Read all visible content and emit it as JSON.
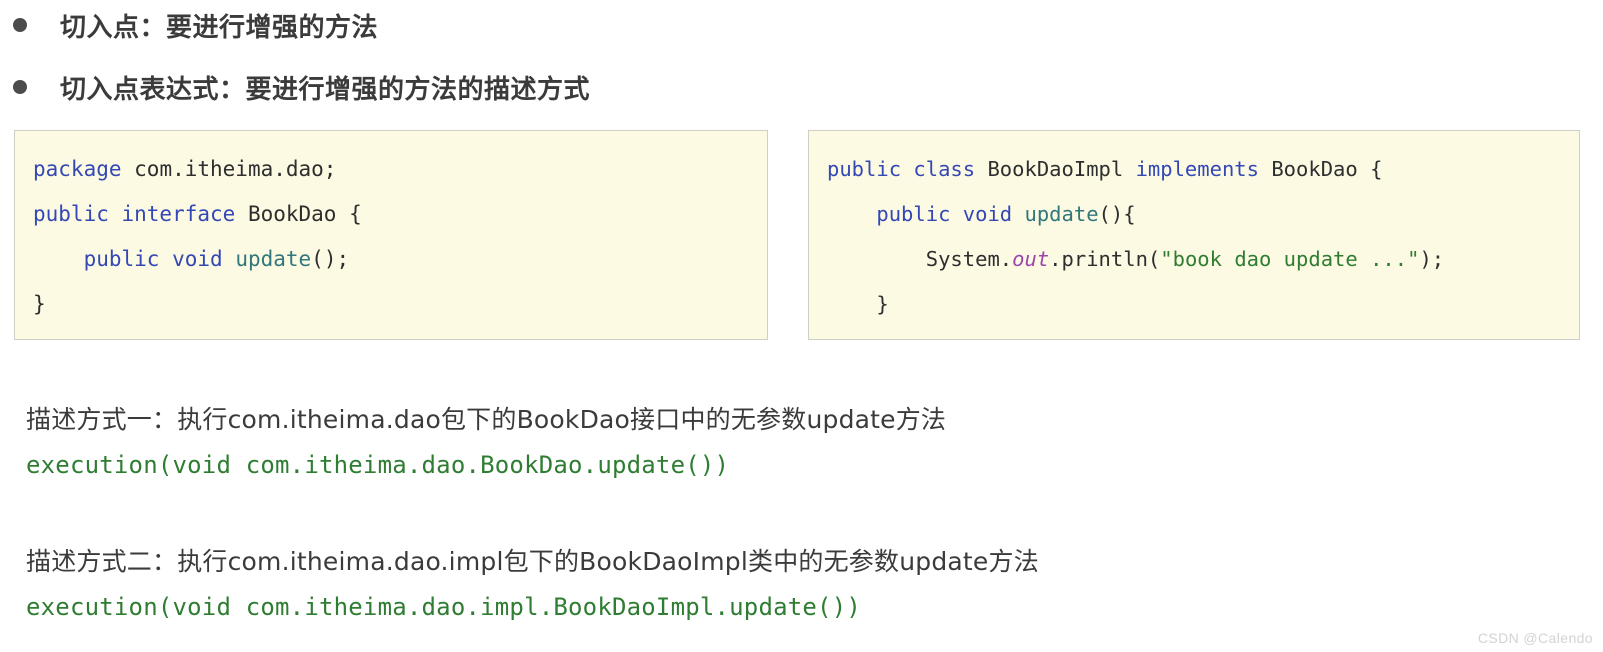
{
  "bullets": [
    {
      "marker": "bullet-dot",
      "text": "切入点：要进行增强的方法"
    },
    {
      "marker": "bullet-dot",
      "text": "切入点表达式：要进行增强的方法的描述方式"
    }
  ],
  "code_blocks": [
    {
      "id": "interface",
      "lines": [
        [
          {
            "t": "package",
            "c": "keyword"
          },
          {
            "t": " com.itheima.dao;",
            "c": "plain"
          }
        ],
        [
          {
            "t": "public interface",
            "c": "keyword"
          },
          {
            "t": " BookDao {",
            "c": "plain"
          }
        ],
        [
          {
            "t": "    ",
            "c": "plain"
          },
          {
            "t": "public void",
            "c": "keyword"
          },
          {
            "t": " ",
            "c": "plain"
          },
          {
            "t": "update",
            "c": "method"
          },
          {
            "t": "();",
            "c": "plain"
          }
        ],
        [
          {
            "t": "}",
            "c": "plain"
          }
        ]
      ]
    },
    {
      "id": "impl",
      "lines": [
        [
          {
            "t": "public class",
            "c": "keyword"
          },
          {
            "t": " BookDaoImpl ",
            "c": "plain"
          },
          {
            "t": "implements",
            "c": "keyword"
          },
          {
            "t": " BookDao {",
            "c": "plain"
          }
        ],
        [
          {
            "t": "    ",
            "c": "plain"
          },
          {
            "t": "public void",
            "c": "keyword"
          },
          {
            "t": " ",
            "c": "plain"
          },
          {
            "t": "update",
            "c": "method"
          },
          {
            "t": "(){",
            "c": "plain"
          }
        ],
        [
          {
            "t": "        System.",
            "c": "plain"
          },
          {
            "t": "out",
            "c": "static"
          },
          {
            "t": ".println(",
            "c": "plain"
          },
          {
            "t": "\"book dao update ...\"",
            "c": "string"
          },
          {
            "t": ");",
            "c": "plain"
          }
        ],
        [
          {
            "t": "    }",
            "c": "plain"
          }
        ],
        [
          {
            "t": "}",
            "c": "plain"
          }
        ]
      ]
    }
  ],
  "descriptions": [
    {
      "title": "描述方式一：执行com.itheima.dao包下的BookDao接口中的无参数update方法",
      "expression": "execution(void com.itheima.dao.BookDao.update())"
    },
    {
      "title": "描述方式二：执行com.itheima.dao.impl包下的BookDaoImpl类中的无参数update方法",
      "expression": "execution(void com.itheima.dao.impl.BookDaoImpl.update())"
    }
  ],
  "watermark": {
    "text": "CSDN @Calendo"
  },
  "colors": {
    "page_background": "#ffffff",
    "code_background": "#fcfae3",
    "code_border": "#cfcfc6",
    "keyword": "#3348b5",
    "method": "#31777b",
    "string": "#2f7d32",
    "static_field": "#9c46ad",
    "body_text": "#3b3b3b",
    "bullet": "#4c4c4c",
    "watermark": "#d3d3d3"
  }
}
